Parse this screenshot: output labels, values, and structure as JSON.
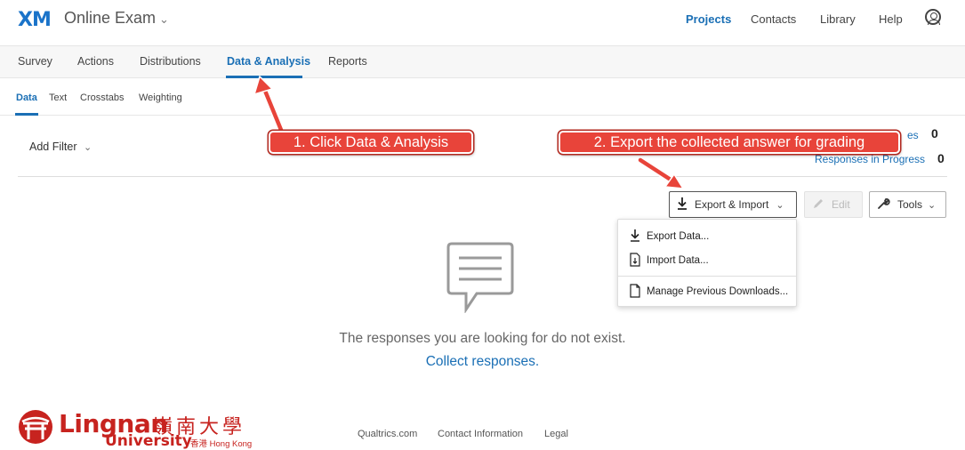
{
  "header": {
    "logo": "XM",
    "project_title": "Online Exam",
    "project_chevron": "⌄",
    "nav": [
      "Projects",
      "Contacts",
      "Library",
      "Help"
    ],
    "active_nav": "Projects",
    "avatar_icon": "user-circle-icon"
  },
  "tabs": {
    "items": [
      "Survey",
      "Actions",
      "Distributions",
      "Data & Analysis",
      "Reports"
    ],
    "active": "Data & Analysis"
  },
  "subtabs": {
    "items": [
      "Data",
      "Text",
      "Crosstabs",
      "Weighting"
    ],
    "active": "Data"
  },
  "filter": {
    "label": "Add Filter",
    "chevron": "⌄"
  },
  "stats": {
    "responses_label_partial": "es",
    "responses_value": "0",
    "in_progress_label": "Responses in Progress",
    "in_progress_value": "0"
  },
  "toolbar": {
    "export_import_label": "Export & Import",
    "edit_label": "Edit",
    "tools_label": "Tools",
    "chevron": "⌄"
  },
  "menu": {
    "export_data": "Export Data...",
    "import_data": "Import Data...",
    "manage_downloads": "Manage Previous Downloads..."
  },
  "empty_state": {
    "message": "The responses you are looking for do not exist.",
    "link": "Collect responses."
  },
  "footer": {
    "logo_en": "Lingnan",
    "logo_zh": "嶺南大學",
    "logo_univ": "University",
    "logo_hk": "香港 Hong Kong",
    "links": [
      "Qualtrics.com",
      "Contact Information",
      "Legal"
    ]
  },
  "annotations": {
    "step1": "1. Click Data & Analysis",
    "step2": "2. Export the collected answer for grading"
  },
  "colors": {
    "accent": "#1a6fb5",
    "callout": "#e8443a",
    "brand_red": "#c7231f"
  }
}
